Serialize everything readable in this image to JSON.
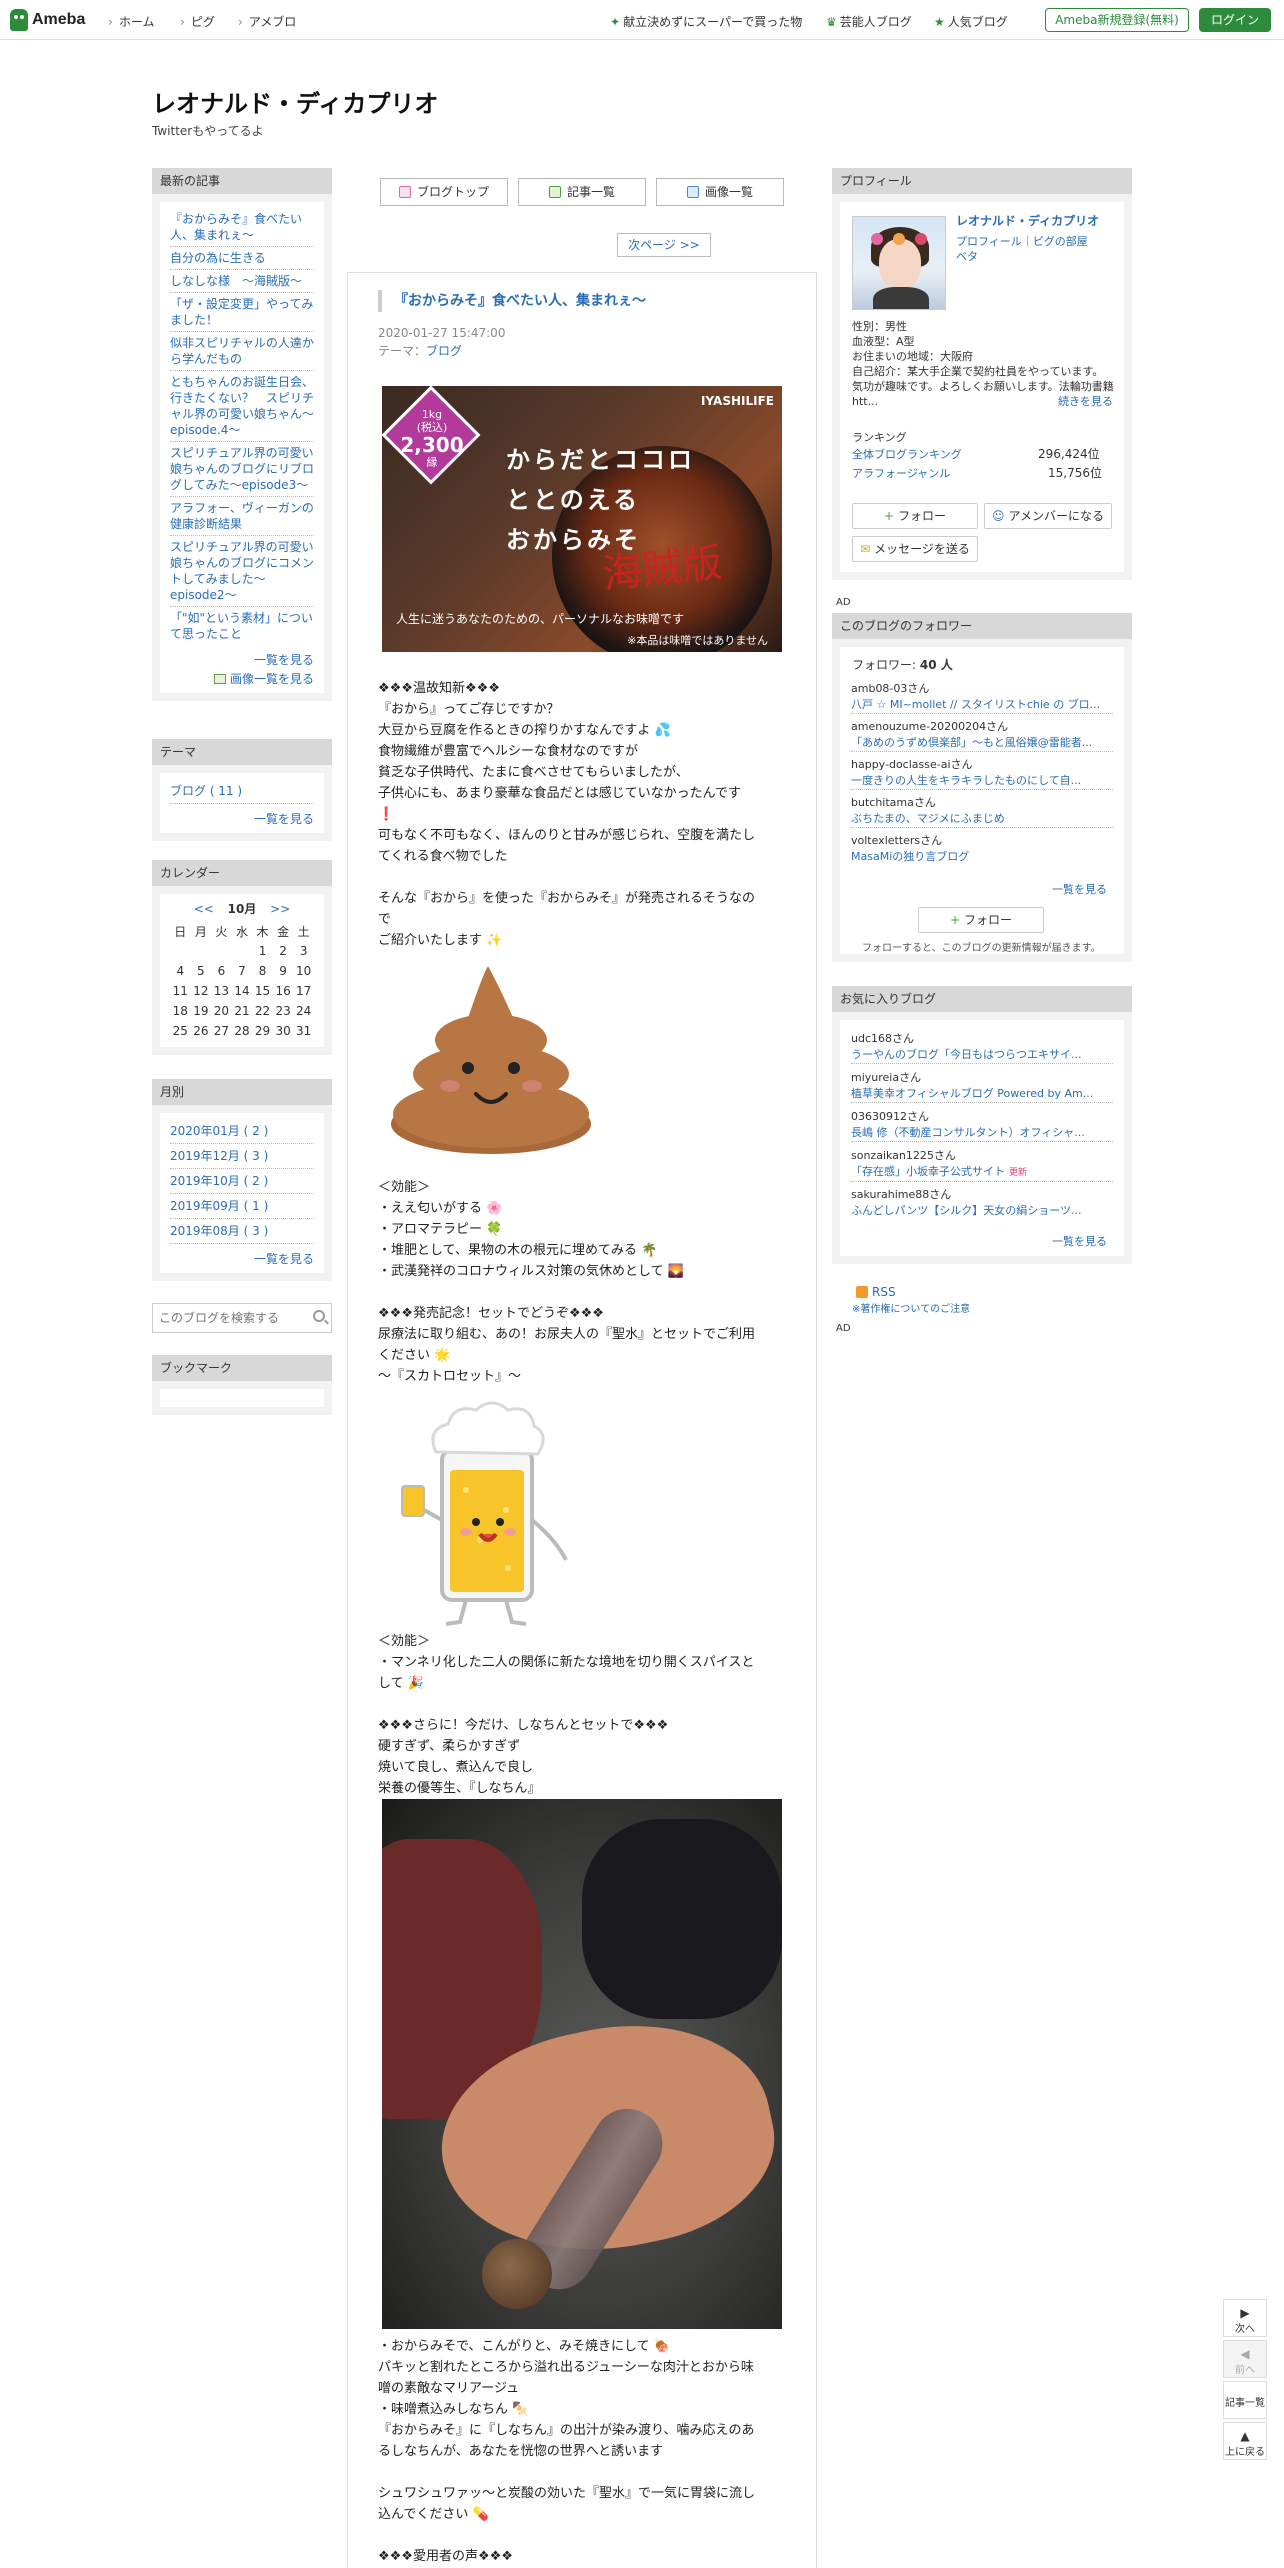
{
  "topbar": {
    "logo": "Ameba",
    "nav": [
      "ホーム",
      "ピグ",
      "アメブロ"
    ],
    "right_links": [
      "献立決めずにスーパーで買った物",
      "芸能人ブログ",
      "人気ブログ"
    ],
    "register": "Ameba新規登録(無料)",
    "login": "ログイン"
  },
  "blog": {
    "title": "レオナルド・ディカプリオ",
    "description": "Twitterもやってるよ"
  },
  "recent": {
    "heading": "最新の記事",
    "items": [
      "『おからみそ』食べたい人、集まれぇ～",
      "自分の為に生きる",
      "しなしな様　～海賊版～",
      "「ザ・設定変更」やってみました！",
      "似非スピリチャルの人達から学んだもの",
      "ともちゃんのお誕生日会、行きたくない？　スピリチャル界の可愛い娘ちゃん～episode.4～",
      "スピリチュアル界の可愛い娘ちゃんのブログにリブログしてみた～episode3～",
      "アラフォー、ヴィーガンの健康診断結果",
      "スピリチュアル界の可愛い娘ちゃんのブログにコメントしてみました～episode2～",
      "「\"如\"という素材」について思ったこと"
    ],
    "more": "一覧を見る",
    "image_list": "画像一覧を見る"
  },
  "theme": {
    "heading": "テーマ",
    "items": [
      "ブログ ( 11 )"
    ],
    "more": "一覧を見る"
  },
  "calendar": {
    "heading": "カレンダー",
    "prev": "<<",
    "month": "10月",
    "next": ">>",
    "weekdays": [
      "日",
      "月",
      "火",
      "水",
      "木",
      "金",
      "土"
    ],
    "weeks": [
      [
        "",
        "",
        "",
        "",
        "1",
        "2",
        "3"
      ],
      [
        "4",
        "5",
        "6",
        "7",
        "8",
        "9",
        "10"
      ],
      [
        "11",
        "12",
        "13",
        "14",
        "15",
        "16",
        "17"
      ],
      [
        "18",
        "19",
        "20",
        "21",
        "22",
        "23",
        "24"
      ],
      [
        "25",
        "26",
        "27",
        "28",
        "29",
        "30",
        "31"
      ]
    ]
  },
  "archive": {
    "heading": "月別",
    "items": [
      "2020年01月 ( 2 )",
      "2019年12月 ( 3 )",
      "2019年10月 ( 2 )",
      "2019年09月 ( 1 )",
      "2019年08月 ( 3 )"
    ],
    "more": "一覧を見る"
  },
  "search": {
    "placeholder": "このブログを検索する"
  },
  "bookmark": {
    "heading": "ブックマーク"
  },
  "center_tabs": [
    "ブログトップ",
    "記事一覧",
    "画像一覧"
  ],
  "next_page": "次ページ >>",
  "entry": {
    "title": "『おからみそ』食べたい人、集まれぇ～",
    "date": "2020-01-27 15:47:00",
    "theme_label": "テーマ：",
    "theme": "ブログ",
    "hero": {
      "badge_top": "1kg",
      "badge_sub": "(税込)",
      "badge_price": "2,300",
      "badge_unit": "縁",
      "brand": "IYASHILIFE",
      "line1": "からだとココロ",
      "line2": "ととのえる",
      "line3": "おからみそ",
      "stamp": "海賊版",
      "caption": "人生に迷うあなたのための、パーソナルなお味噌です",
      "note": "※本品は味噌ではありません"
    },
    "block1": [
      "❖❖❖温故知新❖❖❖",
      "『おから』ってご存じですか？",
      "大豆から豆腐を作るときの搾りかすなんですよ 💦",
      "食物繊維が豊富でヘルシーな食材なのですが",
      "貧乏な子供時代、たまに食べさせてもらいましたが、",
      "子供心にも、あまり豪華な食品だとは感じていなかったんです",
      "❗",
      "可もなく不可もなく、ほんのりと甘みが感じられ、空腹を満たし",
      "てくれる食べ物でした",
      "",
      "そんな『おから』を使った『おからみそ』が発売されるそうなの",
      "で",
      "ご紹介いたします ✨"
    ],
    "block2": [
      "＜効能＞",
      "・ええ匂いがする 🌸",
      "・アロマテラピー 🍀",
      "・堆肥として、果物の木の根元に埋めてみる 🌴",
      "・武漢発祥のコロナウィルス対策の気休めとして 🌄",
      "",
      "❖❖❖発売記念！セットでどうぞ❖❖❖",
      "尿療法に取り組む、あの！お尿夫人の『聖水』とセットでご利用",
      "ください 🌟",
      "～『スカトロセット』～"
    ],
    "block3": [
      "＜効能＞",
      "・マンネリ化した二人の関係に新たな境地を切り開くスパイスと",
      "して 🎉",
      "",
      "❖❖❖さらに！今だけ、しなちんとセットで❖❖❖",
      "硬すぎず、柔らかすぎず",
      "焼いて良し、煮込んで良し",
      "栄養の優等生、『しなちん』"
    ],
    "block4": [
      "・おからみそで、こんがりと、みそ焼きにして 🍖",
      "パキッと割れたところから溢れ出るジューシーな肉汁とおから味",
      "噌の素敵なマリアージュ",
      "・味噌煮込みしなちん 🍢",
      "『おからみそ』に『しなちん』の出汁が染み渡り、噛み応えのあ",
      "るしなちんが、あなたを恍惚の世界へと誘います",
      "",
      "シュワシュワァッ～と炭酸の効いた『聖水』で一気に胃袋に流し",
      "込んでください 💊",
      "",
      "❖❖❖愛用者の声❖❖❖"
    ]
  },
  "profile": {
    "heading": "プロフィール",
    "name": "レオナルド・ディカプリオ",
    "links": "プロフィール｜ピグの部屋",
    "beta": "ベタ",
    "sex": "性別：男性",
    "blood": "血液型：A型",
    "area": "お住まいの地域：大阪府",
    "intro": "自己紹介：某大手企業で契約社員をやっています。気功が趣味です。よろしくお願いします。法輪功書籍　htt...",
    "more": "続きを見る",
    "ranking_label": "ランキング",
    "rank1_label": "全体ブログランキング",
    "rank1_value": "296,424位",
    "rank2_label": "アラフォージャンル",
    "rank2_value": "15,756位",
    "follow": "フォロー",
    "amember": "アメンバーになる",
    "message": "メッセージを送る"
  },
  "ad": "AD",
  "followers": {
    "heading": "このブログのフォロワー",
    "count_label": "フォロワー:",
    "count": "40 人",
    "items": [
      {
        "who": "amb08-03さん",
        "blog": "八戸 ☆ MI~mollet // スタイリストchie の ブロ..."
      },
      {
        "who": "amenouzume-20200204さん",
        "blog": "「あめのうずめ倶楽部」～もと風俗嬢@雷能者..."
      },
      {
        "who": "happy-doclasse-aiさん",
        "blog": "一度きりの人生をキラキラしたものにして自..."
      },
      {
        "who": "butchitamaさん",
        "blog": "ぶちたまの、マジメにふまじめ"
      },
      {
        "who": "voltexlettersさん",
        "blog": "MasaMiの独り言ブログ"
      }
    ],
    "more": "一覧を見る",
    "follow": "フォロー",
    "note": "フォローすると、このブログの更新情報が届きます。"
  },
  "favorites": {
    "heading": "お気に入りブログ",
    "items": [
      {
        "who": "udc168さん",
        "blog": "うーやんのブログ「今日もはつらつエキサイ..."
      },
      {
        "who": "miyureiaさん",
        "blog": "植草美幸オフィシャルブログ Powered by Am..."
      },
      {
        "who": "03630912さん",
        "blog": "長嶋 修（不動産コンサルタント）オフィシャ..."
      },
      {
        "who": "sonzaikan1225さん",
        "blog": "「存在感」小坂幸子公式サイト",
        "tag": "更新"
      },
      {
        "who": "sakurahime88さん",
        "blog": "ふんどしパンツ【シルク】天女の絹ショーツ..."
      }
    ],
    "more": "一覧を見る"
  },
  "rss": {
    "label": "RSS",
    "note": "※著作権についてのご注意"
  },
  "scroll": {
    "next": "次へ",
    "prev": "前へ",
    "list": "記事一覧",
    "top": "上に戻る"
  }
}
